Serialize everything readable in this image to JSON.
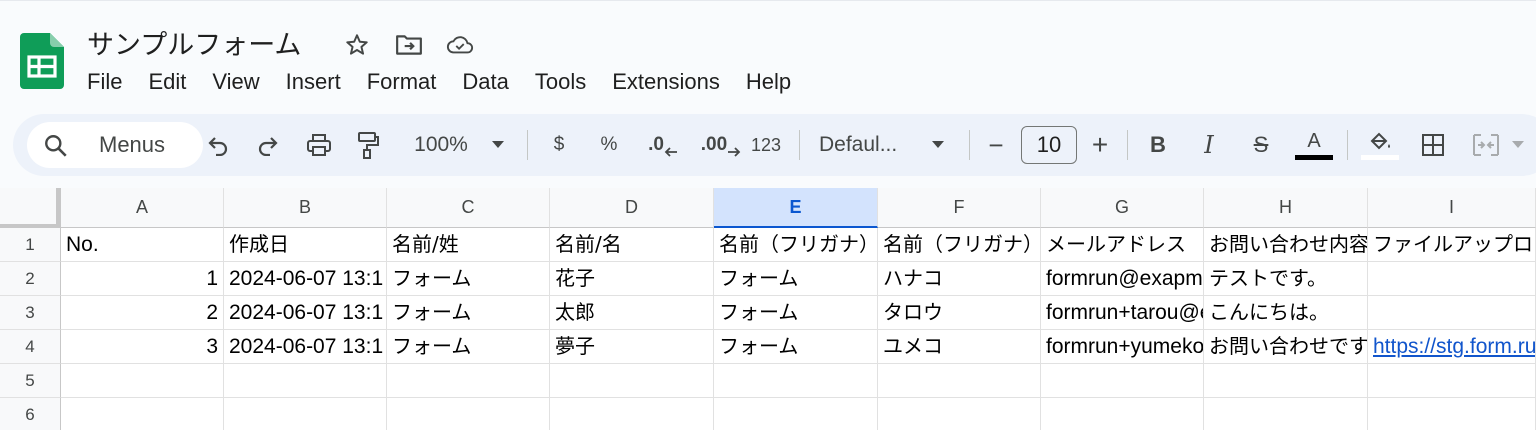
{
  "app": {
    "title": "サンプルフォーム",
    "menu": [
      "File",
      "Edit",
      "View",
      "Insert",
      "Format",
      "Data",
      "Tools",
      "Extensions",
      "Help"
    ]
  },
  "toolbar": {
    "search_label": "Menus",
    "zoom": "100%",
    "currency": "$",
    "percent": "%",
    "decrease_decimal": ".0",
    "increase_decimal": ".00",
    "number_format": "123",
    "font": "Defaul...",
    "font_size": "10",
    "minus": "−",
    "plus": "+",
    "bold": "B",
    "italic": "I",
    "strike": "S",
    "text_color": "A"
  },
  "sheet": {
    "columns": [
      "A",
      "B",
      "C",
      "D",
      "E",
      "F",
      "G",
      "H",
      "I"
    ],
    "selected_column": "E",
    "rows": [
      "1",
      "2",
      "3",
      "4",
      "5",
      "6"
    ],
    "header_row": [
      "No.",
      "作成日",
      "名前/姓",
      "名前/名",
      "名前（フリガナ）",
      "名前（フリガナ）",
      "メールアドレス",
      "お問い合わせ内容",
      "ファイルアップロード"
    ],
    "data": [
      [
        "1",
        "2024-06-07 13:1",
        "フォーム",
        "花子",
        "フォーム",
        "ハナコ",
        "formrun@exapmple.com",
        "テストです。",
        ""
      ],
      [
        "2",
        "2024-06-07 13:1",
        "フォーム",
        "太郎",
        "フォーム",
        "タロウ",
        "formrun+tarou@example.com",
        "こんにちは。",
        ""
      ],
      [
        "3",
        "2024-06-07 13:1",
        "フォーム",
        "夢子",
        "フォーム",
        "ユメコ",
        "formrun+yumeko@example.com",
        "お問い合わせです",
        "https://stg.form.run"
      ]
    ]
  },
  "colors": {
    "accent": "#0b57d0",
    "sheets_green": "#0f9d58",
    "link": "#1155cc"
  }
}
